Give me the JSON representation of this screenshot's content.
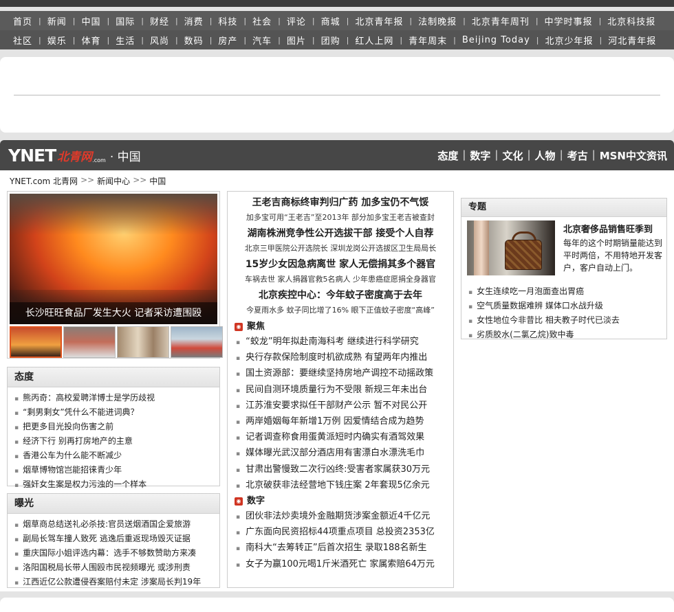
{
  "nav_row1": [
    "首页",
    "新闻",
    "中国",
    "国际",
    "财经",
    "消费",
    "科技",
    "社会",
    "评论",
    "商城",
    "北京青年报",
    "法制晚报",
    "北京青年周刊",
    "中学时事报",
    "北京科技报"
  ],
  "nav_row2": [
    "社区",
    "娱乐",
    "体育",
    "生活",
    "风尚",
    "数码",
    "房产",
    "汽车",
    "图片",
    "团购",
    "红人上网",
    "青年周末",
    "Beijing  Today",
    "北京少年报",
    "河北青年报"
  ],
  "logo": {
    "ynet": "YNET",
    "brand": "北青网",
    "dotcom": ".com",
    "channel": "· 中国"
  },
  "channel_nav": [
    "态度",
    "数字",
    "文化",
    "人物",
    "考古",
    "MSN中文资讯"
  ],
  "breadcrumb": {
    "site": "YNET.com 北青网",
    "sep": ">>",
    "section": "新闻中心",
    "current": "中国"
  },
  "photo": {
    "caption": "长沙旺旺食品厂发生大火 记者采访遭围殴"
  },
  "attitude": {
    "title": "态度",
    "items": [
      "熊丙奇：高校爱聘洋博士是学历歧视",
      "“剩男剩女”凭什么不能进词典？",
      "把更多目光投向伤害之前",
      "经济下行 别再打房地产的主意",
      "香港公车为什么能不断减少",
      "烟草博物馆岂能招徕青少年",
      "强奸女生案是权力污浊的一个样本"
    ]
  },
  "exposure": {
    "title": "曝光",
    "items": [
      "烟草商总结送礼必杀技:官员送烟酒国企爱旅游",
      "副局长驾车撞人致死 逃逸后重返现场毁灭证据",
      "重庆国际小姐评选内幕：选手不够数赞助方来凑",
      "洛阳国税局长带人围殴市民视频曝光 或涉刑责",
      "江西近亿公款遭侵吞案赔付未定 涉案局长判19年"
    ]
  },
  "stories": [
    {
      "headline": "王老吉商标终审判归广药 加多宝仍不气馁",
      "sub": "加多宝可用“王老吉”至2013年 部分加多宝王老吉被查封"
    },
    {
      "headline": "湖南株洲竞争性公开选拔干部 接受个人自荐",
      "sub": "北京三甲医院公开选院长 深圳龙岗公开选拔区卫生局局长"
    },
    {
      "headline": "15岁少女因急病离世 家人无偿捐其多个器官",
      "sub": "车祸去世 家人捐器官救5名病人 少年患癌症愿捐全身器官"
    },
    {
      "headline": "北京疾控中心：今年蚊子密度高于去年",
      "sub": "今夏雨水多 蚊子同比增了16% 眼下正值蚊子密度“高峰”"
    }
  ],
  "focus": {
    "title": "聚焦",
    "items": [
      "“蛟龙”明年拟赴南海科考 继续进行科学研究",
      "央行存款保险制度时机欲成熟 有望两年内推出",
      "国土资源部：要继续坚持房地产调控不动摇政策",
      "民间自测环境质量行为不受限 新规三年未出台",
      "江苏淮安要求拟任干部财产公示 暂不对民公开",
      "两岸婚姻每年新增1万例 因爱情结合成为趋势",
      "记者调查称食用蛋黄派短时内确实有酒驾效果",
      "媒体曝光武汉部分酒店用有害漂白水漂洗毛巾",
      "甘肃出警慢致二次行凶终:受害者家属获30万元",
      "北京破获非法经营地下钱庄案 2年套现5亿余元"
    ]
  },
  "numbers": {
    "title": "数字",
    "items": [
      "团伙非法炒卖境外金融期货涉案金额近4千亿元",
      "广东面向民资招标44项重点项目 总投资2353亿",
      "南科大“去筹转正”后首次招生 录取188名新生",
      "女子为赢100元喝1斤米酒死亡 家属索赔64万元"
    ]
  },
  "special": {
    "title": "专题",
    "feature_title": "北京奢侈品销售旺季到",
    "feature_desc": "每年的这个时期销量能达到平时两倍，不用特地开发客户，客户自动上门。",
    "items": [
      "女生连续吃一月泡面查出胃癌",
      "空气质量数据难辨 媒体口水战升级",
      "女性地位今非昔比 相夫教子时代已淡去",
      "劣质胶水(二氯乙烷)致中毒"
    ]
  },
  "icons": {
    "rss": "rss-icon",
    "bullet": "square-bullet-icon"
  },
  "colors": {
    "nav_bg": "#5b5b5b",
    "channel_bg": "#474747",
    "brand_red": "#e03a2a",
    "rss_red": "#d03522"
  }
}
